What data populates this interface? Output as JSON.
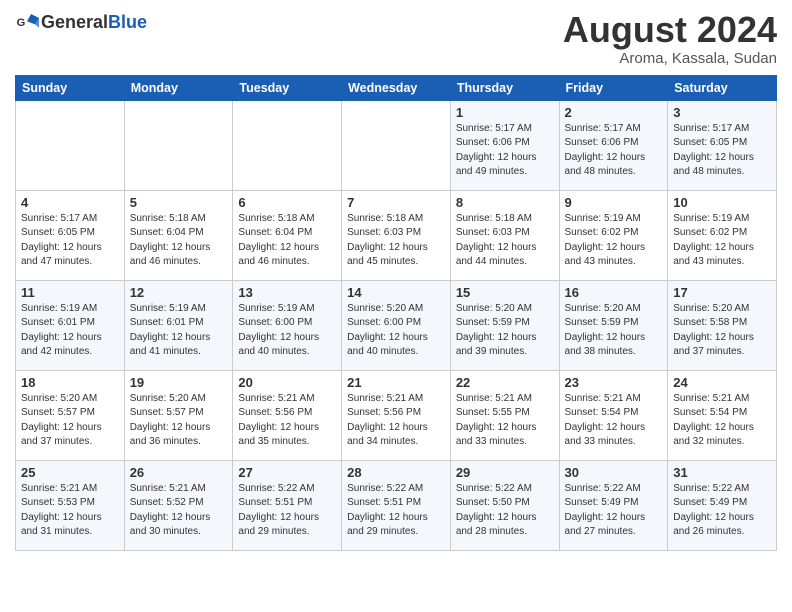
{
  "header": {
    "logo_general": "General",
    "logo_blue": "Blue",
    "month_year": "August 2024",
    "location": "Aroma, Kassala, Sudan"
  },
  "days_of_week": [
    "Sunday",
    "Monday",
    "Tuesday",
    "Wednesday",
    "Thursday",
    "Friday",
    "Saturday"
  ],
  "weeks": [
    [
      {
        "day": "",
        "info": ""
      },
      {
        "day": "",
        "info": ""
      },
      {
        "day": "",
        "info": ""
      },
      {
        "day": "",
        "info": ""
      },
      {
        "day": "1",
        "info": "Sunrise: 5:17 AM\nSunset: 6:06 PM\nDaylight: 12 hours\nand 49 minutes."
      },
      {
        "day": "2",
        "info": "Sunrise: 5:17 AM\nSunset: 6:06 PM\nDaylight: 12 hours\nand 48 minutes."
      },
      {
        "day": "3",
        "info": "Sunrise: 5:17 AM\nSunset: 6:05 PM\nDaylight: 12 hours\nand 48 minutes."
      }
    ],
    [
      {
        "day": "4",
        "info": "Sunrise: 5:17 AM\nSunset: 6:05 PM\nDaylight: 12 hours\nand 47 minutes."
      },
      {
        "day": "5",
        "info": "Sunrise: 5:18 AM\nSunset: 6:04 PM\nDaylight: 12 hours\nand 46 minutes."
      },
      {
        "day": "6",
        "info": "Sunrise: 5:18 AM\nSunset: 6:04 PM\nDaylight: 12 hours\nand 46 minutes."
      },
      {
        "day": "7",
        "info": "Sunrise: 5:18 AM\nSunset: 6:03 PM\nDaylight: 12 hours\nand 45 minutes."
      },
      {
        "day": "8",
        "info": "Sunrise: 5:18 AM\nSunset: 6:03 PM\nDaylight: 12 hours\nand 44 minutes."
      },
      {
        "day": "9",
        "info": "Sunrise: 5:19 AM\nSunset: 6:02 PM\nDaylight: 12 hours\nand 43 minutes."
      },
      {
        "day": "10",
        "info": "Sunrise: 5:19 AM\nSunset: 6:02 PM\nDaylight: 12 hours\nand 43 minutes."
      }
    ],
    [
      {
        "day": "11",
        "info": "Sunrise: 5:19 AM\nSunset: 6:01 PM\nDaylight: 12 hours\nand 42 minutes."
      },
      {
        "day": "12",
        "info": "Sunrise: 5:19 AM\nSunset: 6:01 PM\nDaylight: 12 hours\nand 41 minutes."
      },
      {
        "day": "13",
        "info": "Sunrise: 5:19 AM\nSunset: 6:00 PM\nDaylight: 12 hours\nand 40 minutes."
      },
      {
        "day": "14",
        "info": "Sunrise: 5:20 AM\nSunset: 6:00 PM\nDaylight: 12 hours\nand 40 minutes."
      },
      {
        "day": "15",
        "info": "Sunrise: 5:20 AM\nSunset: 5:59 PM\nDaylight: 12 hours\nand 39 minutes."
      },
      {
        "day": "16",
        "info": "Sunrise: 5:20 AM\nSunset: 5:59 PM\nDaylight: 12 hours\nand 38 minutes."
      },
      {
        "day": "17",
        "info": "Sunrise: 5:20 AM\nSunset: 5:58 PM\nDaylight: 12 hours\nand 37 minutes."
      }
    ],
    [
      {
        "day": "18",
        "info": "Sunrise: 5:20 AM\nSunset: 5:57 PM\nDaylight: 12 hours\nand 37 minutes."
      },
      {
        "day": "19",
        "info": "Sunrise: 5:20 AM\nSunset: 5:57 PM\nDaylight: 12 hours\nand 36 minutes."
      },
      {
        "day": "20",
        "info": "Sunrise: 5:21 AM\nSunset: 5:56 PM\nDaylight: 12 hours\nand 35 minutes."
      },
      {
        "day": "21",
        "info": "Sunrise: 5:21 AM\nSunset: 5:56 PM\nDaylight: 12 hours\nand 34 minutes."
      },
      {
        "day": "22",
        "info": "Sunrise: 5:21 AM\nSunset: 5:55 PM\nDaylight: 12 hours\nand 33 minutes."
      },
      {
        "day": "23",
        "info": "Sunrise: 5:21 AM\nSunset: 5:54 PM\nDaylight: 12 hours\nand 33 minutes."
      },
      {
        "day": "24",
        "info": "Sunrise: 5:21 AM\nSunset: 5:54 PM\nDaylight: 12 hours\nand 32 minutes."
      }
    ],
    [
      {
        "day": "25",
        "info": "Sunrise: 5:21 AM\nSunset: 5:53 PM\nDaylight: 12 hours\nand 31 minutes."
      },
      {
        "day": "26",
        "info": "Sunrise: 5:21 AM\nSunset: 5:52 PM\nDaylight: 12 hours\nand 30 minutes."
      },
      {
        "day": "27",
        "info": "Sunrise: 5:22 AM\nSunset: 5:51 PM\nDaylight: 12 hours\nand 29 minutes."
      },
      {
        "day": "28",
        "info": "Sunrise: 5:22 AM\nSunset: 5:51 PM\nDaylight: 12 hours\nand 29 minutes."
      },
      {
        "day": "29",
        "info": "Sunrise: 5:22 AM\nSunset: 5:50 PM\nDaylight: 12 hours\nand 28 minutes."
      },
      {
        "day": "30",
        "info": "Sunrise: 5:22 AM\nSunset: 5:49 PM\nDaylight: 12 hours\nand 27 minutes."
      },
      {
        "day": "31",
        "info": "Sunrise: 5:22 AM\nSunset: 5:49 PM\nDaylight: 12 hours\nand 26 minutes."
      }
    ]
  ]
}
